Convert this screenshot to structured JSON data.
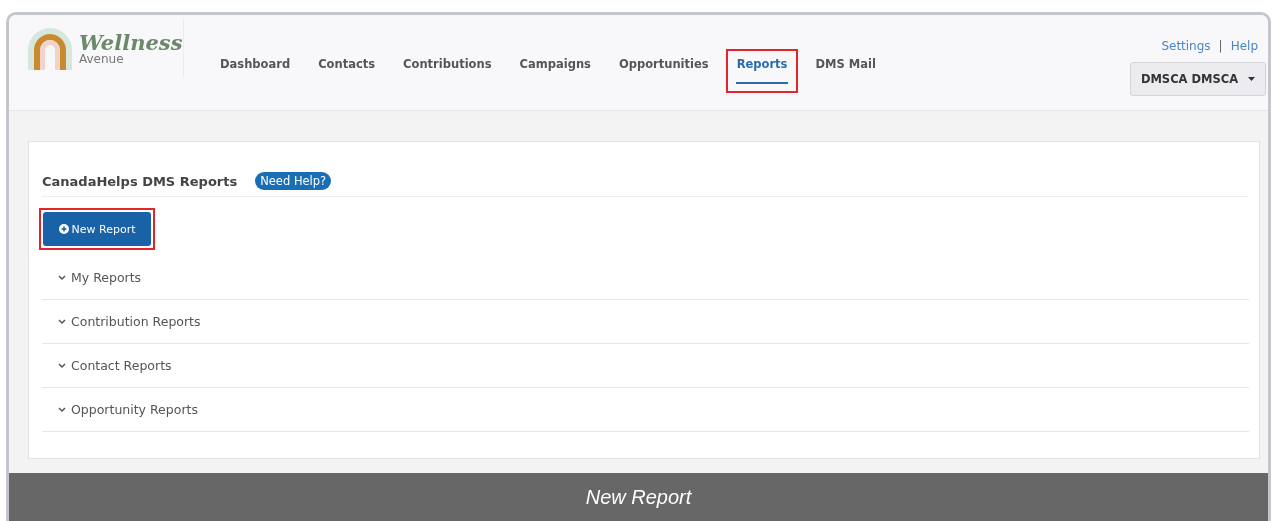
{
  "logo": {
    "title": "Wellness",
    "subtitle": "Avenue"
  },
  "nav": [
    {
      "label": "Dashboard",
      "selected": false,
      "highlighted": false
    },
    {
      "label": "Contacts",
      "selected": false,
      "highlighted": false
    },
    {
      "label": "Contributions",
      "selected": false,
      "highlighted": false
    },
    {
      "label": "Campaigns",
      "selected": false,
      "highlighted": false
    },
    {
      "label": "Opportunities",
      "selected": false,
      "highlighted": false
    },
    {
      "label": "Reports",
      "selected": true,
      "highlighted": true
    },
    {
      "label": "DMS Mail",
      "selected": false,
      "highlighted": false
    }
  ],
  "top_links": {
    "settings": "Settings",
    "separator": "|",
    "help": "Help"
  },
  "user_menu": {
    "label": "DMSCA DMSCA"
  },
  "panel": {
    "title": "CanadaHelps DMS Reports",
    "help_badge": "Need Help?",
    "new_report_button": {
      "label": "New Report",
      "highlighted": true
    },
    "sections": [
      {
        "label": "My Reports",
        "expanded": false
      },
      {
        "label": "Contribution Reports",
        "expanded": false
      },
      {
        "label": "Contact Reports",
        "expanded": false
      },
      {
        "label": "Opportunity Reports",
        "expanded": false
      }
    ]
  },
  "footer": {
    "title": "New Report"
  }
}
